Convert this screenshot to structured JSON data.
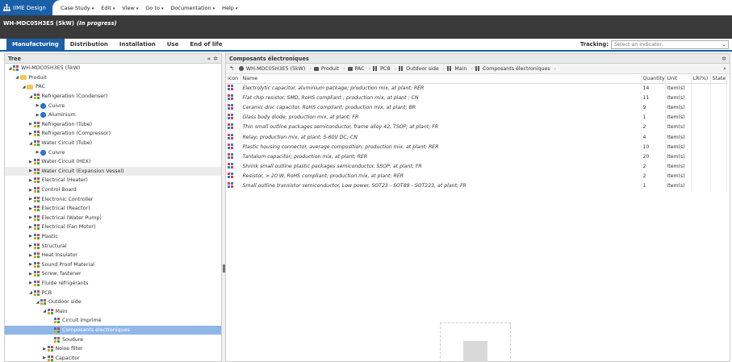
{
  "app": {
    "name": "IIME Design"
  },
  "menu": [
    {
      "label": "Case Study"
    },
    {
      "label": "Edit"
    },
    {
      "label": "View"
    },
    {
      "label": "Go to"
    },
    {
      "label": "Documentation"
    },
    {
      "label": "Help"
    }
  ],
  "title": {
    "text": "WH-MDC05H3E5 (5kW)",
    "status": "(In progress)"
  },
  "tabs": [
    {
      "label": "Manufacturing",
      "active": true
    },
    {
      "label": "Distribution"
    },
    {
      "label": "Installation"
    },
    {
      "label": "Use"
    },
    {
      "label": "End of life"
    }
  ],
  "tracking": {
    "label": "Tracking:",
    "placeholder": "Select an indicator."
  },
  "tree": {
    "title": "Tree",
    "items": [
      {
        "label": "WH-MDC05H3E5 (5kW)",
        "depth": 0,
        "toggle": "open",
        "icon": "case"
      },
      {
        "label": "Produit",
        "depth": 1,
        "toggle": "open",
        "icon": "folder"
      },
      {
        "label": "PAC",
        "depth": 2,
        "toggle": "open",
        "icon": "folder"
      },
      {
        "label": "Refrigeration (Condenser)",
        "depth": 3,
        "toggle": "open",
        "icon": "grid"
      },
      {
        "label": "Cuivre",
        "depth": 4,
        "toggle": "closed",
        "icon": "gear"
      },
      {
        "label": "Aluminium",
        "depth": 4,
        "toggle": "closed",
        "icon": "gear"
      },
      {
        "label": "Refrigeration (Tube)",
        "depth": 3,
        "toggle": "closed",
        "icon": "grid"
      },
      {
        "label": "Refrigeration (Compressor)",
        "depth": 3,
        "toggle": "closed",
        "icon": "grid"
      },
      {
        "label": "Water Circuit (Tube)",
        "depth": 3,
        "toggle": "open",
        "icon": "grid"
      },
      {
        "label": "Cuivre",
        "depth": 4,
        "toggle": "closed",
        "icon": "gear"
      },
      {
        "label": "Water Circuit (HEX)",
        "depth": 3,
        "toggle": "closed",
        "icon": "grid"
      },
      {
        "label": "Water Circuit (Expansion Vessel)",
        "depth": 3,
        "toggle": "closed",
        "icon": "grid",
        "hover": true
      },
      {
        "label": "Electrical (Heater)",
        "depth": 3,
        "toggle": "closed",
        "icon": "grid"
      },
      {
        "label": "Control Board",
        "depth": 3,
        "toggle": "closed",
        "icon": "grid"
      },
      {
        "label": "Electronic Controller",
        "depth": 3,
        "toggle": "closed",
        "icon": "grid"
      },
      {
        "label": "Electrical (Reactor)",
        "depth": 3,
        "toggle": "closed",
        "icon": "grid"
      },
      {
        "label": "Electrical (Water Pump)",
        "depth": 3,
        "toggle": "closed",
        "icon": "grid"
      },
      {
        "label": "Electrical (Fan Motor)",
        "depth": 3,
        "toggle": "closed",
        "icon": "grid"
      },
      {
        "label": "Plastic",
        "depth": 3,
        "toggle": "closed",
        "icon": "grid"
      },
      {
        "label": "Structural",
        "depth": 3,
        "toggle": "closed",
        "icon": "grid"
      },
      {
        "label": "Heat Insulator",
        "depth": 3,
        "toggle": "closed",
        "icon": "grid"
      },
      {
        "label": "Sound Proof Material",
        "depth": 3,
        "toggle": "closed",
        "icon": "grid"
      },
      {
        "label": "Screw, fastener",
        "depth": 3,
        "toggle": "closed",
        "icon": "grid"
      },
      {
        "label": "Fluide réfrigérants",
        "depth": 3,
        "toggle": "closed",
        "icon": "grid"
      },
      {
        "label": "PCB",
        "depth": 3,
        "toggle": "open",
        "icon": "grid"
      },
      {
        "label": "Outdoor side",
        "depth": 4,
        "toggle": "open",
        "icon": "grid"
      },
      {
        "label": "Main",
        "depth": 5,
        "toggle": "open",
        "icon": "grid"
      },
      {
        "label": "Circuit imprimé",
        "depth": 6,
        "toggle": "none",
        "icon": "grid"
      },
      {
        "label": "Composants électroniques",
        "depth": 6,
        "toggle": "none",
        "icon": "grid",
        "selected": true
      },
      {
        "label": "Soudure",
        "depth": 6,
        "toggle": "none",
        "icon": "grid"
      },
      {
        "label": "Noise filter",
        "depth": 5,
        "toggle": "closed",
        "icon": "grid"
      },
      {
        "label": "Capacitor",
        "depth": 5,
        "toggle": "closed",
        "icon": "grid"
      }
    ]
  },
  "detail": {
    "title": "Composants électroniques",
    "breadcrumb": [
      {
        "label": "WH-MDC05H3E5 (5kW)",
        "icon": "gear"
      },
      {
        "label": "Produit",
        "icon": "folder"
      },
      {
        "label": "PAC",
        "icon": "folder"
      },
      {
        "label": "PCB",
        "icon": "grid"
      },
      {
        "label": "Outdoor side",
        "icon": "grid"
      },
      {
        "label": "Main",
        "icon": "grid"
      },
      {
        "label": "Composants électroniques",
        "icon": "grid"
      }
    ],
    "columns": [
      "Icon",
      "Name",
      "Quantity",
      "Unit",
      "LR(%)",
      "State"
    ],
    "rows": [
      {
        "name": "Electrolytic capacitor, aluminium package; production mix, at plant; RER",
        "qty": "14",
        "unit": "Item(s)"
      },
      {
        "name": "Flat chip resistor, SMD, RoHS compliant ; production mix, at plant ; CN",
        "qty": "11",
        "unit": "Item(s)"
      },
      {
        "name": "Ceramic disc capacitor, RoHS compliant; production mix, at plant; BR",
        "qty": "9",
        "unit": "Item(s)"
      },
      {
        "name": "Glass body diode; production mix, at plant; FR",
        "qty": "1",
        "unit": "Item(s)"
      },
      {
        "name": "Thin small outline packages semiconductor, frame alloy 42, TSOP; at plant; FR",
        "qty": "2",
        "unit": "Item(s)"
      },
      {
        "name": "Relay; production mix, at plant; 5-60V DC; CN",
        "qty": "4",
        "unit": "Item(s)"
      },
      {
        "name": "Plastic housing connector, average composition; production mix, at plant; RER",
        "qty": "10",
        "unit": "Item(s)"
      },
      {
        "name": "Tantalum capacitor; production mix, at plant; RER",
        "qty": "20",
        "unit": "Item(s)"
      },
      {
        "name": "Shrink small outline plastic packages semiconductor, SSOP; at plant; FR",
        "qty": "2",
        "unit": "Item(s)"
      },
      {
        "name": "Resistor, > 20 W, RoHS compliant; production mix, at plant; RER",
        "qty": "2",
        "unit": "Item(s)"
      },
      {
        "name": "Small outline transistor semiconductor, Low power, SOT23 - SOT89 - SOT223, at plant; FR",
        "qty": "1",
        "unit": "Item(s)"
      }
    ]
  },
  "colors": {
    "brand": "#1a5fa8",
    "titlebar": "#3a3a3a",
    "selection": "#8fb6e8"
  }
}
